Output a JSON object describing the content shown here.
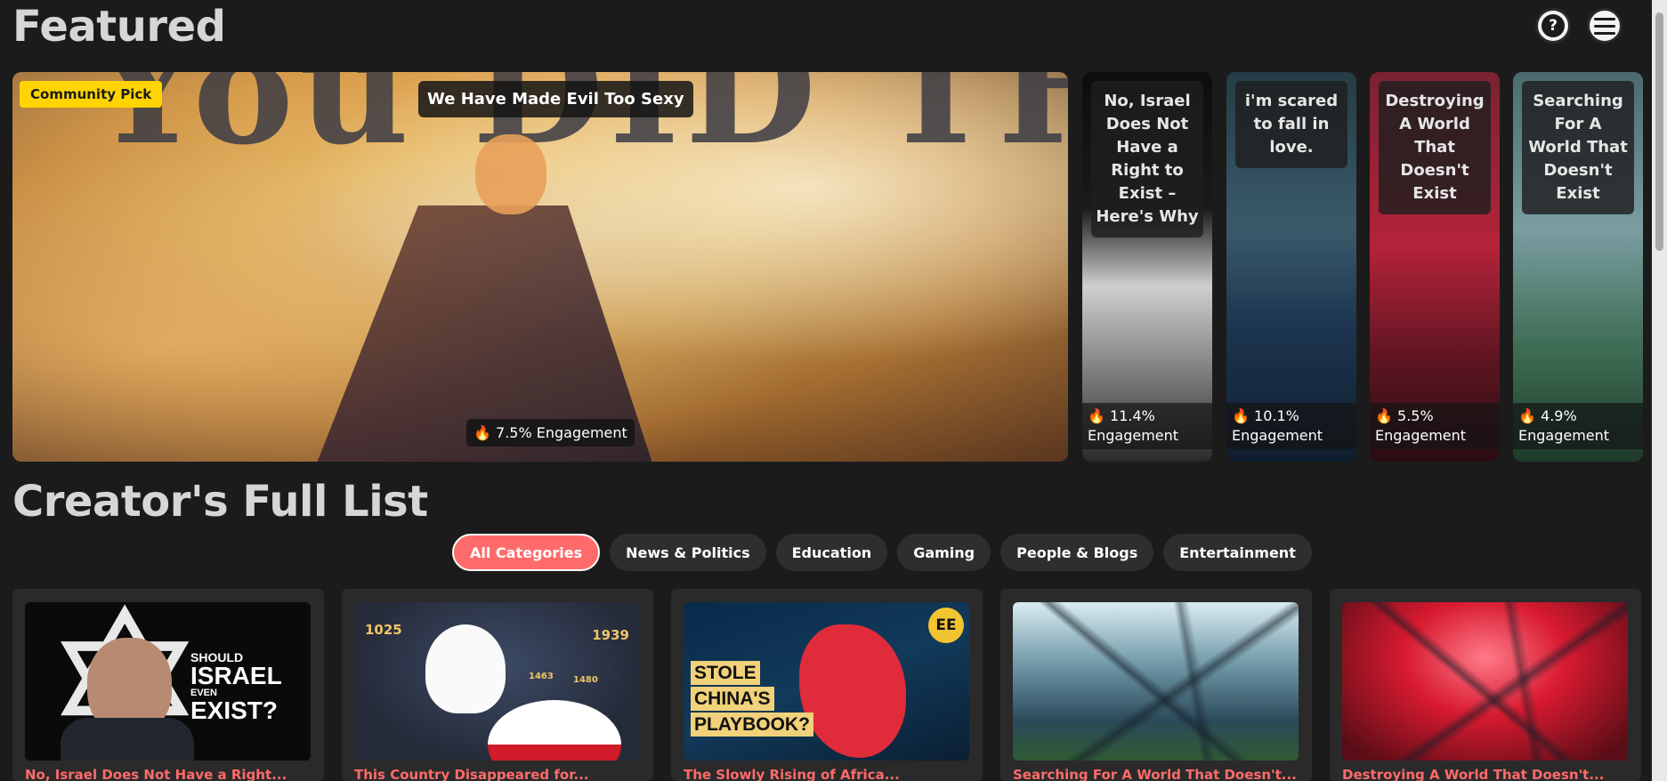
{
  "featured": {
    "title": "Featured",
    "hero": {
      "badge": "Community Pick",
      "title": "We Have Made Evil Too Sexy",
      "engagement": "7.5% Engagement",
      "art_text": "You DID THIS"
    },
    "side_cards": [
      {
        "title": "No, Israel Does Not Have a Right to Exist – Here's Why",
        "engagement_value": "11.4%",
        "engagement_label": "Engagement"
      },
      {
        "title": "i'm scared to fall in love.",
        "engagement_value": "10.1%",
        "engagement_label": "Engagement"
      },
      {
        "title": "Destroying A World That Doesn't Exist",
        "engagement_value": "5.5%",
        "engagement_label": "Engagement"
      },
      {
        "title": "Searching For A World That Doesn't Exist",
        "engagement_value": "4.9%",
        "engagement_label": "Engagement"
      }
    ]
  },
  "header": {
    "help_icon": "question-icon",
    "menu_icon": "hamburger-menu-icon"
  },
  "creators": {
    "title": "Creator's Full List",
    "tabs": [
      {
        "label": "All Categories",
        "active": true
      },
      {
        "label": "News & Politics",
        "active": false
      },
      {
        "label": "Education",
        "active": false
      },
      {
        "label": "Gaming",
        "active": false
      },
      {
        "label": "People & Blogs",
        "active": false
      },
      {
        "label": "Entertainment",
        "active": false
      }
    ],
    "cards": [
      {
        "thumb_text_small": "SHOULD",
        "thumb_text_large": "ISRAEL",
        "thumb_text_mid": "EVEN",
        "thumb_text_large2": "EXIST?",
        "caption": "No, Israel Does Not Have a Right..."
      },
      {
        "thumb_nums": [
          "1025",
          "1939",
          "1463",
          "1480"
        ],
        "caption": "This Country Disappeared for..."
      },
      {
        "thumb_caption_lines": [
          "STOLE",
          "CHINA'S",
          "PLAYBOOK?"
        ],
        "thumb_badge": "EE",
        "caption": "The Slowly Rising of Africa..."
      },
      {
        "caption": "Searching For A World That Doesn't..."
      },
      {
        "caption": "Destroying A World That Doesn't..."
      }
    ]
  },
  "colors": {
    "background": "#1b1b1b",
    "accent": "#ff6b6b",
    "badge": "#ffd400"
  }
}
